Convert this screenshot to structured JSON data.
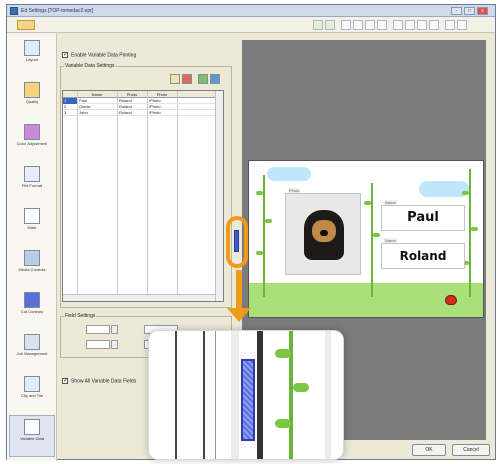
{
  "window": {
    "title": "Ed Settings [TOP-tomedac2.epr]",
    "min_label": "-",
    "max_label": "□",
    "close_label": "x"
  },
  "nav": [
    {
      "label": "Layout",
      "icon": "layout-icon"
    },
    {
      "label": "Quality",
      "icon": "quality-icon"
    },
    {
      "label": "Color Adjustment",
      "icon": "color-adjustment-icon"
    },
    {
      "label": "File Format",
      "icon": "file-format-icon"
    },
    {
      "label": "Mark",
      "icon": "mark-icon"
    },
    {
      "label": "Media Controls",
      "icon": "media-controls-icon"
    },
    {
      "label": "Cut Controls",
      "icon": "cut-controls-icon"
    },
    {
      "label": "Job Management",
      "icon": "job-management-icon"
    },
    {
      "label": "Clip and Tile",
      "icon": "clip-tile-icon"
    },
    {
      "label": "Variable Data",
      "icon": "variable-data-icon",
      "active": true
    }
  ],
  "settings": {
    "enable_label": "Enable Variable Data Printing",
    "group_label": "Variable Data Settings",
    "columns": [
      "",
      "Name",
      "Photo",
      "Photo"
    ],
    "rows": [
      {
        "n": "1",
        "name": "Paul",
        "a": "Roland",
        "b": "\\Photo"
      },
      {
        "n": "2",
        "name": "Ginnie",
        "a": "Roland",
        "b": "\\Photo"
      },
      {
        "n": "3",
        "name": "John",
        "a": "Roland",
        "b": "\\Photo"
      }
    ],
    "field_settings_label": "Field Settings",
    "show_all_label": "Show All Variable Data Fields"
  },
  "preview": {
    "photo_label": "Photo",
    "name_label_1": "Name",
    "name_1": "Paul",
    "name_label_2": "Name",
    "name_2": "Roland"
  },
  "buttons": {
    "ok": "OK",
    "cancel": "Cancel"
  },
  "colors": {
    "highlight": "#f09a1a",
    "grass": "#a9e07a",
    "sky": "#bfe6fb"
  }
}
